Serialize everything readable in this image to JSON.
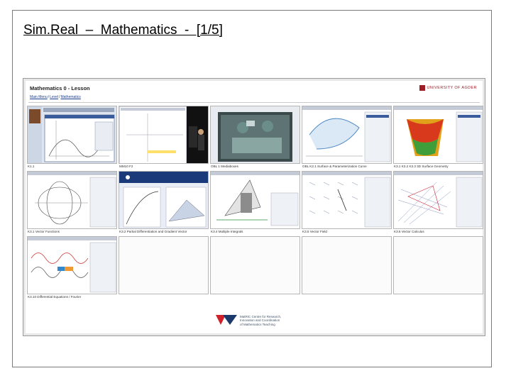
{
  "slide": {
    "title": "Sim.Real  –  Mathematics  -  [1/5]"
  },
  "lesson": {
    "title": "Mathematics 0 - Lesson",
    "breadcrumb": [
      "Main Menu",
      "Level",
      "Mathematics"
    ],
    "university": "UNIVERSITY OF AGDER"
  },
  "tiles": [
    {
      "caption": "K1.1",
      "icon": "desktop-app-icon"
    },
    {
      "caption": "MM10 F2",
      "icon": "lecture-video-icon"
    },
    {
      "caption": "OBL 1 Mediaboxes",
      "icon": "surgery-video-icon"
    },
    {
      "caption": "OBL K2.1 Surface & Parameterization Curve",
      "icon": "curve-plot-icon"
    },
    {
      "caption": "K3.1 K3.2 K3.3 3D Surface Geometry",
      "icon": "3d-surface-icon"
    },
    {
      "caption": "K3.1 Vector Functions",
      "icon": "vector-function-icon"
    },
    {
      "caption": "K3.2 Partial Differentiation and Gradient Vector",
      "icon": "gradient-icon"
    },
    {
      "caption": "K3.4 Multiple Integrals",
      "icon": "integral-icon"
    },
    {
      "caption": "K3.5 Vector Field",
      "icon": "vector-field-icon"
    },
    {
      "caption": "K3.6 Vector Calculus",
      "icon": "vector-calculus-icon"
    },
    {
      "caption": "K3.10 Differential Equations / Fourier",
      "icon": "fourier-icon"
    },
    {
      "caption": "",
      "icon": ""
    },
    {
      "caption": "",
      "icon": ""
    },
    {
      "caption": "",
      "icon": ""
    },
    {
      "caption": "",
      "icon": ""
    }
  ],
  "footer": {
    "logo": "MatRIC",
    "lines": [
      "MatRIC Centre for Research,",
      "Innovation and Coordination",
      "of Mathematics Teaching"
    ]
  },
  "colors": {
    "frame": "#7a7a7a",
    "brand": "#a01d26",
    "matric_blue": "#1b3a6b",
    "matric_red": "#d0202a"
  }
}
